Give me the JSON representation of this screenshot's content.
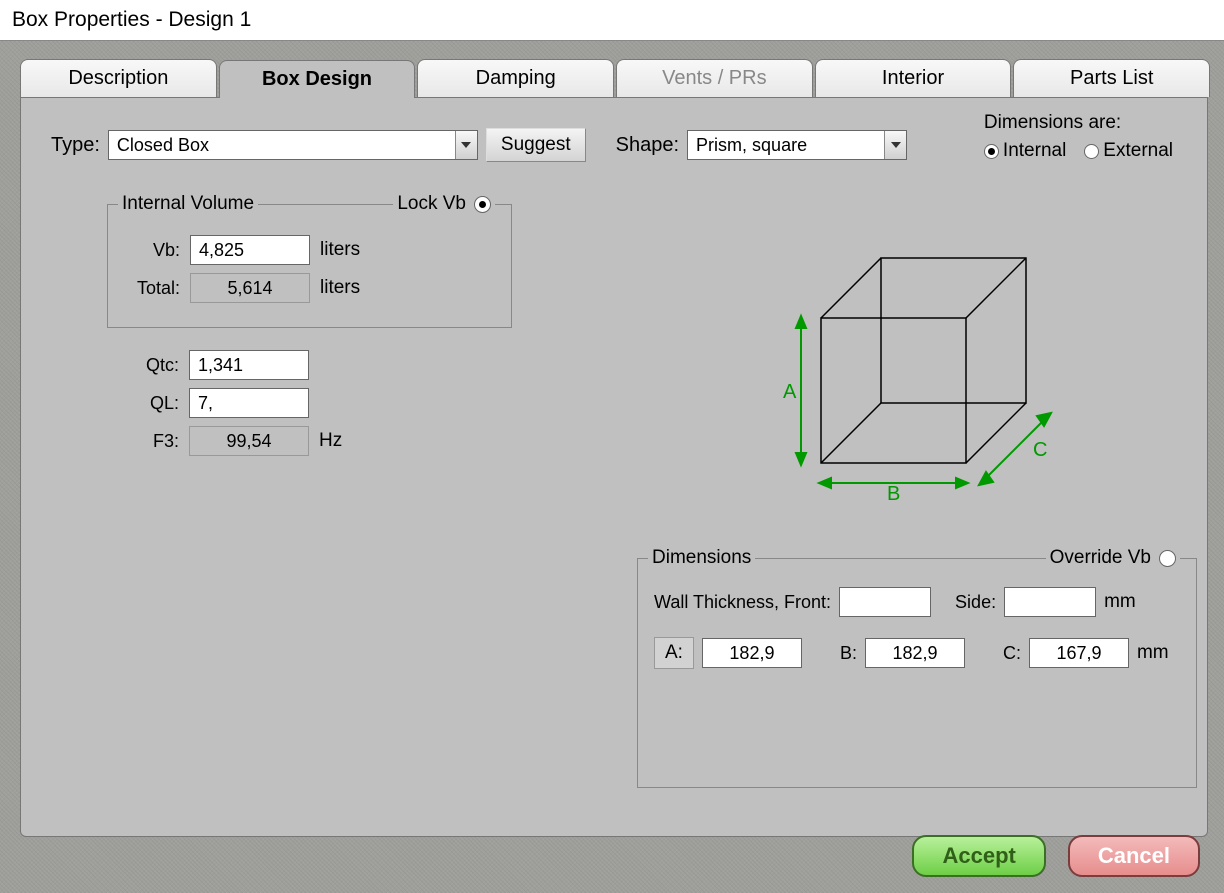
{
  "window": {
    "title": "Box Properties - Design 1"
  },
  "tabs": {
    "description": "Description",
    "box_design": "Box Design",
    "damping": "Damping",
    "vents": "Vents / PRs",
    "interior": "Interior",
    "parts": "Parts List"
  },
  "row1": {
    "type_label": "Type:",
    "type_value": "Closed Box",
    "suggest": "Suggest",
    "shape_label": "Shape:",
    "shape_value": "Prism, square",
    "dims_are": "Dimensions are:",
    "internal": "Internal",
    "external": "External"
  },
  "volume": {
    "legend": "Internal Volume",
    "lock": "Lock Vb",
    "vb_label": "Vb:",
    "vb_value": "4,825",
    "vb_unit": "liters",
    "total_label": "Total:",
    "total_value": "5,614",
    "total_unit": "liters"
  },
  "params": {
    "qtc_label": "Qtc:",
    "qtc_value": "1,341",
    "ql_label": "QL:",
    "ql_value": "7,",
    "f3_label": "F3:",
    "f3_value": "99,54",
    "f3_unit": "Hz"
  },
  "cube": {
    "A": "A",
    "B": "B",
    "C": "C"
  },
  "dims": {
    "legend": "Dimensions",
    "override": "Override Vb",
    "wall_label": "Wall Thickness, Front:",
    "side_label": "Side:",
    "mm": "mm",
    "A_label": "A:",
    "A_value": "182,9",
    "B_label": "B:",
    "B_value": "182,9",
    "C_label": "C:",
    "C_value": "167,9"
  },
  "footer": {
    "accept": "Accept",
    "cancel": "Cancel"
  }
}
